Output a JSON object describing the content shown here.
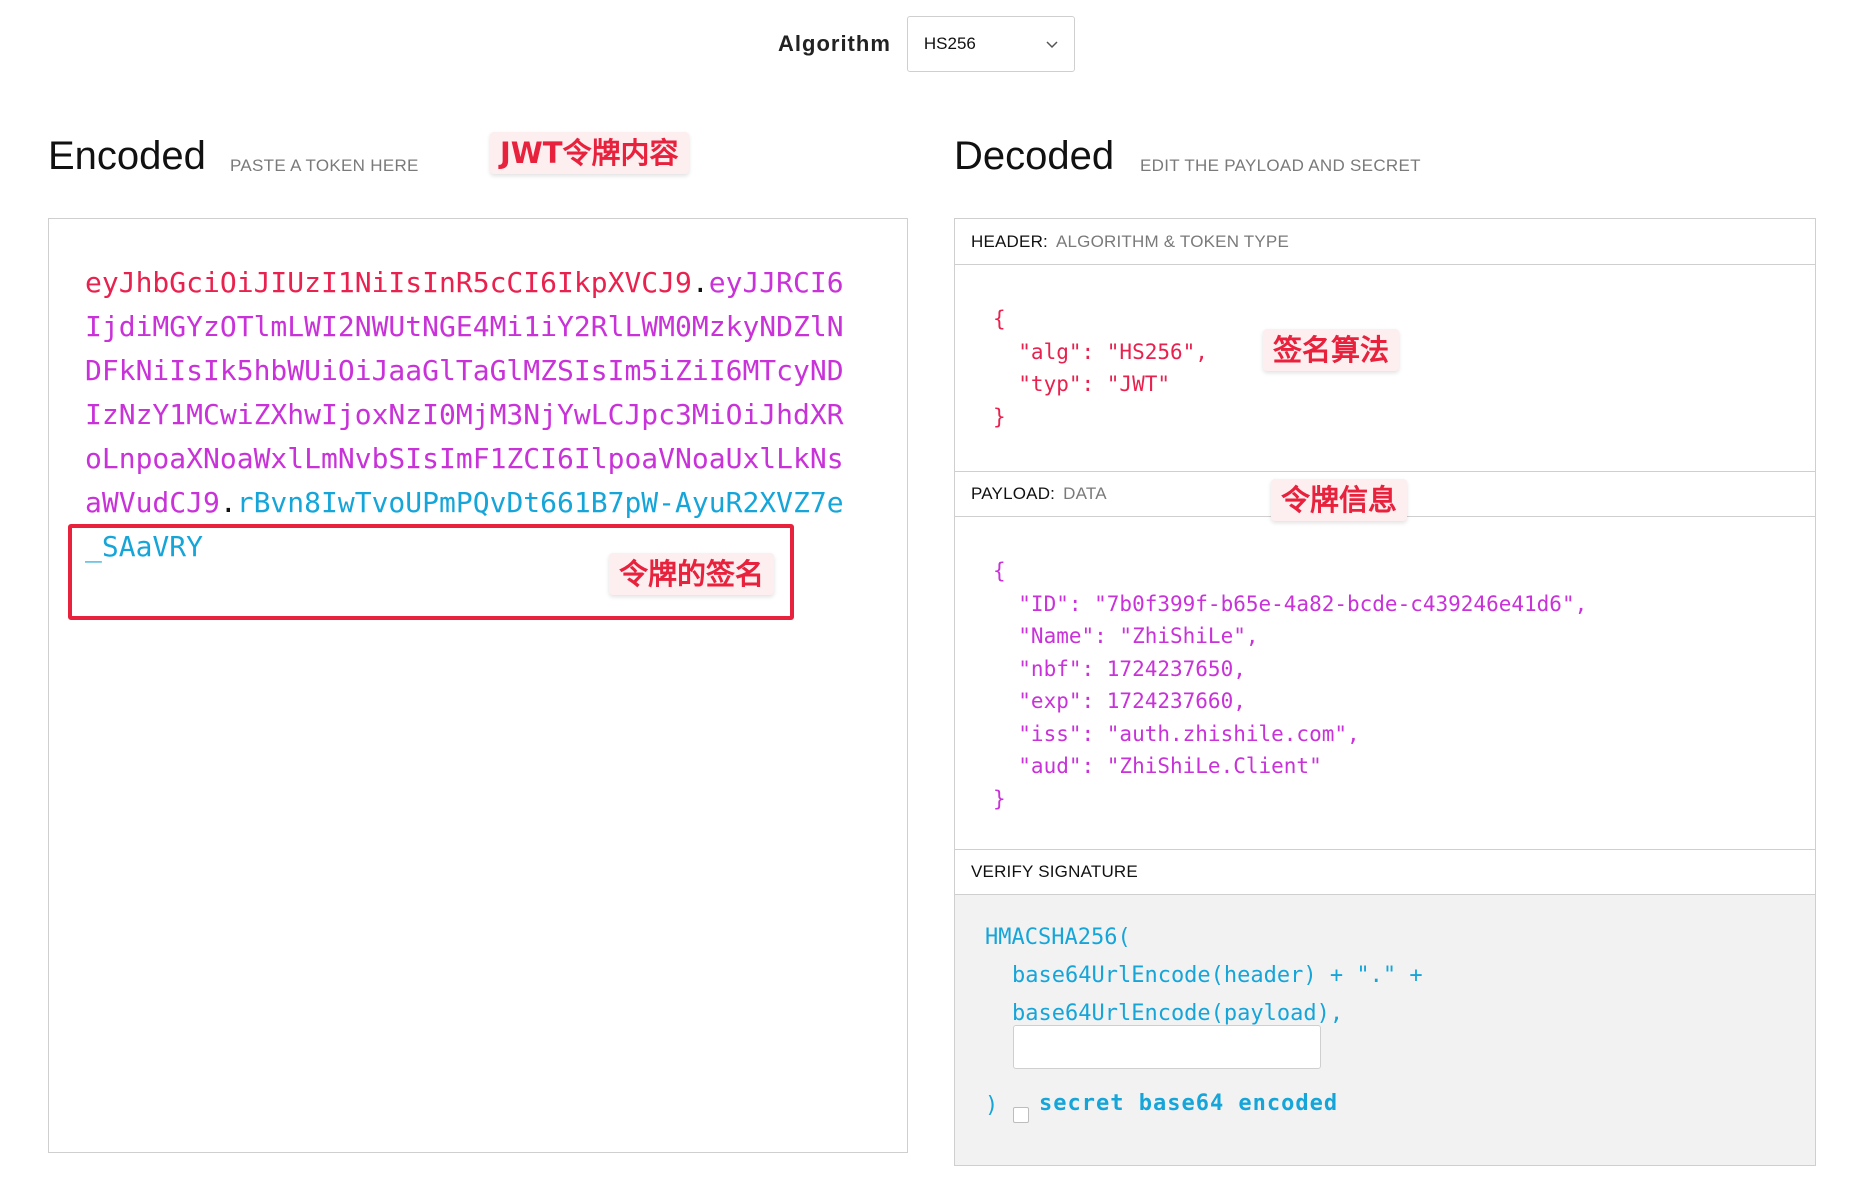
{
  "algorithm": {
    "label": "Algorithm",
    "selected": "HS256"
  },
  "encoded": {
    "title": "Encoded",
    "subtitle": "PASTE A TOKEN HERE",
    "annotation": "JWT令牌内容",
    "token_header": "eyJhbGciOiJIUzI1NiIsInR5cCI6IkpXVCJ9",
    "token_payload": "eyJJRCI6IjdiMGYzOTlmLWI2NWUtNGE4Mi1iY2RlLWM0MzkyNDZlNDFkNiIsIk5hbWUiOiJaaGlTaGlMZSIsIm5iZiI6MTcyNDIzNzY1MCwiZXhwIjoxNzI0MjM3NjYwLCJpc3MiOiJhdXRoLnpoaXNoaWxlLmNvbSIsImF1ZCI6IlpoaVNoaUxlLkNsaWVudCJ9",
    "token_signature": "rBvn8IwTvoUPmPQvDt661B7pW-AyuR2XVZ7e_SAaVRY",
    "dot": ".",
    "signature_annotation": "令牌的签名"
  },
  "decoded": {
    "title": "Decoded",
    "subtitle": "EDIT THE PAYLOAD AND SECRET",
    "header_section": {
      "label": "HEADER:",
      "sublabel": "ALGORITHM & TOKEN TYPE",
      "annotation": "签名算法"
    },
    "header_json": "{\n  \"alg\": \"HS256\",\n  \"typ\": \"JWT\"\n}",
    "payload_section": {
      "label": "PAYLOAD:",
      "sublabel": "DATA",
      "annotation": "令牌信息"
    },
    "payload_json": "{\n  \"ID\": \"7b0f399f-b65e-4a82-bcde-c439246e41d6\",\n  \"Name\": \"ZhiShiLe\",\n  \"nbf\": 1724237650,\n  \"exp\": 1724237660,\n  \"iss\": \"auth.zhishile.com\",\n  \"aud\": \"ZhiShiLe.Client\"\n}",
    "verify_section": {
      "label": "VERIFY SIGNATURE",
      "line1": "HMACSHA256(",
      "line2": "base64UrlEncode(header) + \".\" +",
      "line3": "base64UrlEncode(payload),",
      "close": ")",
      "secret_value": "",
      "checkbox_label": "secret base64 encoded"
    }
  },
  "colors": {
    "header": "#e8214e",
    "payload": "#c832d8",
    "signature": "#16a5d9",
    "annotation": "#e8213c"
  }
}
